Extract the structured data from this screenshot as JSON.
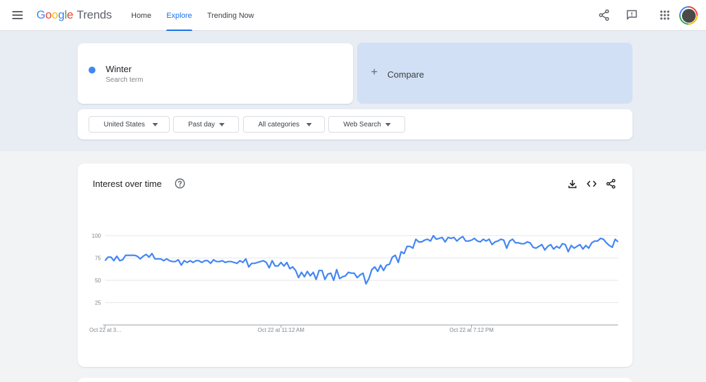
{
  "header": {
    "logo_google": [
      "G",
      "o",
      "o",
      "g",
      "l",
      "e"
    ],
    "logo_product": "Trends",
    "nav": [
      {
        "label": "Home",
        "active": false
      },
      {
        "label": "Explore",
        "active": true
      },
      {
        "label": "Trending Now",
        "active": false
      }
    ],
    "icons": [
      "menu-icon",
      "share-icon",
      "feedback-icon",
      "apps-icon",
      "avatar"
    ]
  },
  "search": {
    "term": "Winter",
    "term_sub": "Search term",
    "term_color": "#4285f4",
    "compare_label": "Compare"
  },
  "filters": [
    {
      "label": "United States"
    },
    {
      "label": "Past day"
    },
    {
      "label": "All categories"
    },
    {
      "label": "Web Search"
    }
  ],
  "interest": {
    "title": "Interest over time",
    "icons": [
      "help-icon",
      "download-icon",
      "embed-icon",
      "share-icon"
    ]
  },
  "chart_data": {
    "type": "line",
    "title": "Interest over time",
    "ylim": [
      0,
      100
    ],
    "yticks": [
      "100",
      "75",
      "50",
      "25"
    ],
    "ytick_values": [
      100,
      75,
      50,
      25
    ],
    "xticks": [
      "Oct 22 at 3…",
      "Oct 22 at 11:12 AM",
      "Oct 22 at 7:12 PM"
    ],
    "xtick_positions": [
      0,
      60,
      125
    ],
    "grid": true,
    "series": [
      {
        "color": "#4285f4",
        "values": [
          72,
          76,
          76,
          72,
          77,
          72,
          73,
          78,
          78,
          78,
          78,
          77,
          74,
          77,
          79,
          76,
          80,
          74,
          74,
          74,
          72,
          74,
          72,
          71,
          71,
          73,
          67,
          72,
          70,
          72,
          70,
          72,
          72,
          70,
          72,
          72,
          69,
          73,
          71,
          71,
          72,
          70,
          71,
          71,
          70,
          69,
          72,
          70,
          74,
          65,
          69,
          69,
          70,
          71,
          72,
          70,
          64,
          72,
          66,
          66,
          70,
          66,
          70,
          63,
          65,
          61,
          53,
          59,
          54,
          60,
          55,
          59,
          51,
          61,
          61,
          51,
          57,
          58,
          50,
          62,
          52,
          54,
          55,
          59,
          58,
          58,
          53,
          56,
          58,
          46,
          52,
          62,
          65,
          60,
          67,
          61,
          67,
          68,
          76,
          78,
          70,
          82,
          80,
          88,
          88,
          86,
          96,
          93,
          93,
          95,
          96,
          94,
          100,
          96,
          97,
          98,
          93,
          98,
          97,
          98,
          94,
          97,
          99,
          94,
          94,
          95,
          97,
          94,
          93,
          96,
          94,
          96,
          90,
          93,
          94,
          96,
          95,
          86,
          94,
          96,
          92,
          92,
          91,
          91,
          93,
          92,
          87,
          86,
          88,
          90,
          84,
          88,
          90,
          85,
          88,
          86,
          91,
          90,
          82,
          89,
          86,
          88,
          90,
          85,
          89,
          86,
          92,
          94,
          94,
          97,
          96,
          92,
          89,
          87,
          96,
          93
        ]
      }
    ]
  }
}
